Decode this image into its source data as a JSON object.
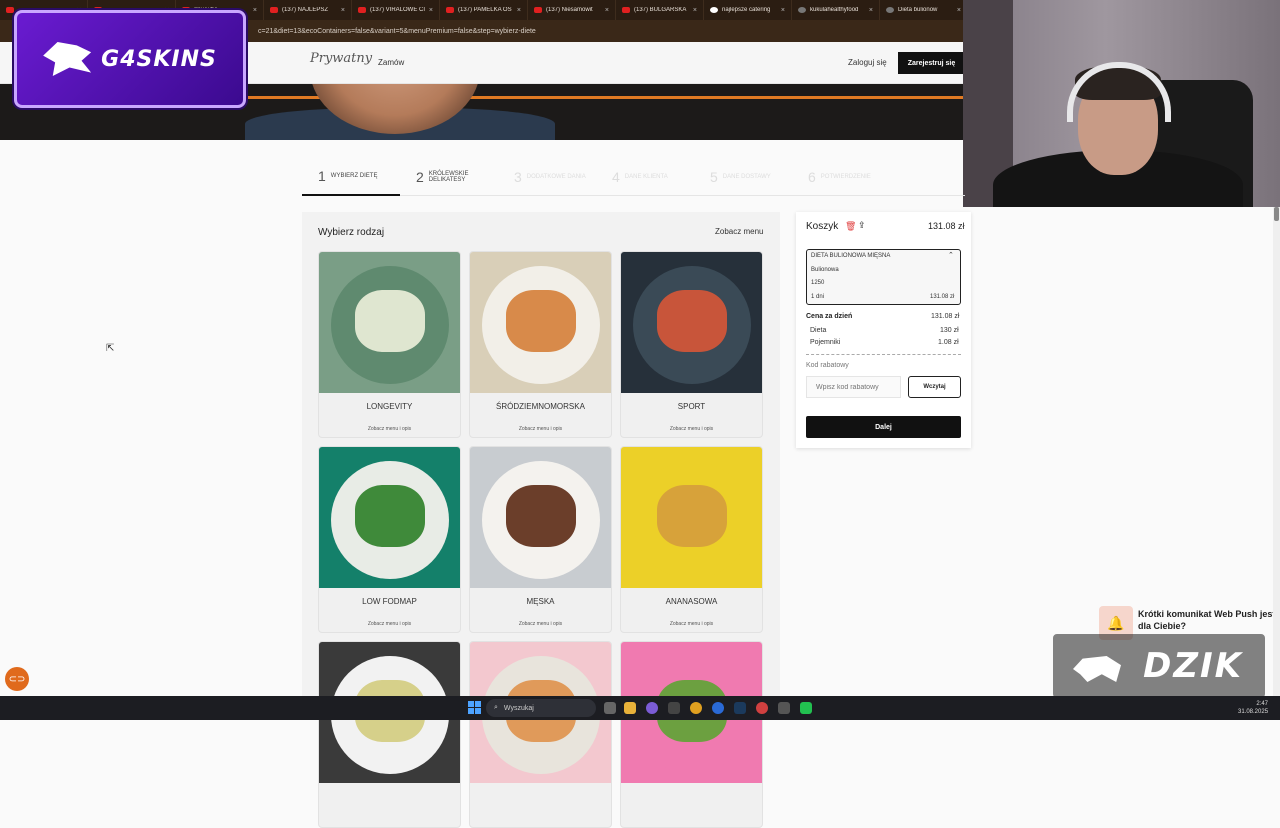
{
  "browser": {
    "tabs": [
      {
        "title": "",
        "type": "dot"
      },
      {
        "title": "",
        "type": "dot"
      },
      {
        "title": "",
        "type": "yt"
      },
      {
        "title": "(137) NAJLEPSZ",
        "type": "yt",
        "audio": true
      },
      {
        "title": "(137) VIRALOWE CI",
        "type": "yt"
      },
      {
        "title": "(137) PAMELKA OS",
        "type": "yt"
      },
      {
        "title": "(137) Niesamowit",
        "type": "yt"
      },
      {
        "title": "(137) BULGARSKA",
        "type": "yt"
      },
      {
        "title": "najlepsze catering",
        "type": "g"
      },
      {
        "title": "kukulahealthyfood",
        "type": "k"
      },
      {
        "title": "Dieta bulionow",
        "type": "k"
      }
    ],
    "tab_extra": "YouTube",
    "url": "c=21&diet=13&ecoContainers=false&variant=5&menuPremium=false&step=wybierz-diete"
  },
  "header": {
    "logo": "Prywatny",
    "nav_order": "Zamów",
    "login": "Zaloguj się",
    "register": "Zarejestruj się"
  },
  "overlay": {
    "sponsor": "G4SKINS",
    "channel": "DZIK"
  },
  "stepper": [
    {
      "num": "1",
      "label": "Wybierz dietę",
      "state": "active"
    },
    {
      "num": "2",
      "label": "Królewskie delikatesy",
      "state": "normal"
    },
    {
      "num": "3",
      "label": "Dodatkowe dania",
      "state": "dim"
    },
    {
      "num": "4",
      "label": "Dane klienta",
      "state": "dim"
    },
    {
      "num": "5",
      "label": "Dane dostawy",
      "state": "dim"
    },
    {
      "num": "6",
      "label": "Potwierdzenie",
      "state": "dim"
    }
  ],
  "diets": {
    "title": "Wybierz rodzaj",
    "see_menu": "Zobacz menu",
    "items": [
      {
        "name": "LONGEVITY",
        "sub": "Zobacz menu i opis",
        "bg": "#7a9e86",
        "plate": "#5f8a6f",
        "food": "#dfe6d0"
      },
      {
        "name": "ŚRÓDZIEMNOMORSKA",
        "sub": "Zobacz menu i opis",
        "bg": "#d9cfb8",
        "plate": "#f2efe8",
        "food": "#d88a4a"
      },
      {
        "name": "SPORT",
        "sub": "Zobacz menu i opis",
        "bg": "#26303a",
        "plate": "#3a4a56",
        "food": "#c8553a"
      },
      {
        "name": "LOW FODMAP",
        "sub": "Zobacz menu i opis",
        "bg": "#14806a",
        "plate": "#e8ece6",
        "food": "#3f8a3a"
      },
      {
        "name": "MĘSKA",
        "sub": "Zobacz menu i opis",
        "bg": "#c8ccd0",
        "plate": "#f4f2ee",
        "food": "#6b3e2a"
      },
      {
        "name": "ANANASOWA",
        "sub": "Zobacz menu i opis",
        "bg": "#ecd028",
        "plate": "#ecd028",
        "food": "#d7a23a"
      },
      {
        "name": "",
        "sub": "",
        "bg": "#3a3a3a",
        "plate": "#f2f2f2",
        "food": "#d6d08a"
      },
      {
        "name": "",
        "sub": "",
        "bg": "#f3c8cf",
        "plate": "#e8e4dc",
        "food": "#e09a5a"
      },
      {
        "name": "",
        "sub": "",
        "bg": "#f07ab0",
        "plate": "#f07ab0",
        "food": "#6ca040"
      }
    ]
  },
  "cart": {
    "title": "Koszyk",
    "total": "131.08 zł",
    "item": {
      "name": "DIETA BULIONOWA MIĘSNA",
      "variant": "Bulionowa",
      "kcal": "1250",
      "days": "1 dni",
      "price": "131.08 zł"
    },
    "price_per_day_label": "Cena za dzień",
    "price_per_day": "131.08 zł",
    "diet_label": "Dieta",
    "diet_price": "130 zł",
    "containers_label": "Pojemniki",
    "containers_price": "1.08 zł",
    "promo_label": "Kod rabatowy",
    "promo_placeholder": "Wpisz kod rabatowy",
    "promo_button": "Wczytaj",
    "next": "Dalej"
  },
  "push": {
    "text": "Krótki komunikat Web Push jest dla Ciebie?"
  },
  "taskbar": {
    "search": "Wyszukaj",
    "time": "2:47",
    "date": "31.08.2025"
  },
  "colors": {
    "accent": "#111111",
    "hero_stripe": "#e07a23",
    "sponsor": "#6a1bd1",
    "cookie": "#e06a1c"
  }
}
